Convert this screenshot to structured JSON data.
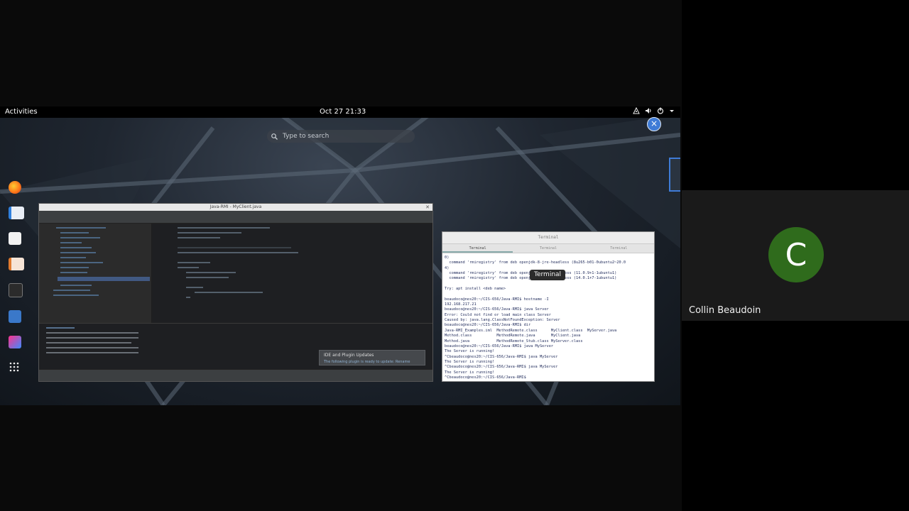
{
  "topbar": {
    "activities_label": "Activities",
    "clock": "Oct 27  21:33",
    "tray_icons": [
      "network-icon",
      "volume-icon",
      "power-icon",
      "menu-caret-icon"
    ]
  },
  "search": {
    "placeholder": "Type to search"
  },
  "dock": {
    "apps": [
      "firefox-icon",
      "writer-icon",
      "document-viewer-icon",
      "impress-icon",
      "terminal-icon",
      "files-icon",
      "intellij-icon",
      "show-apps-icon"
    ]
  },
  "ide_window": {
    "title": "Java-RMI - MyClient.java",
    "notification_title": "IDE and Plugin Updates",
    "notification_text": "The following plugin is ready to update: Rename"
  },
  "terminal_window": {
    "title": "Terminal",
    "tabs": [
      "Terminal",
      "Terminal",
      "Terminal"
    ],
    "lines": [
      "0)",
      "  command 'rmiregistry' from deb openjdk-8-jre-headless (8u265-b01-0ubuntu2~20.0",
      "4)",
      "  command 'rmiregistry' from deb openjdk-11-jre-headless (11.0.9+1-1ubuntu1)",
      "  command 'rmiregistry' from deb openjdk-14-jre-headless (14.0.1+7-1ubuntu1)",
      "",
      "Try: apt install <deb name>",
      "",
      "beaudoco@nes20:~/CIS-656/Java-RMI$ hostname -I",
      "192.168.217.21",
      "beaudoco@nes20:~/CIS-656/Java-RMI$ java Server",
      "Error: Could not find or load main class Server",
      "Caused by: java.lang.ClassNotFoundException: Server",
      "beaudoco@nes20:~/CIS-656/Java-RMI$ dir",
      "Java-RMI_Examples.iml  MethodRemote.class      MyClient.class  MyServer.java",
      "Method.class           MethodRemote.java       MyClient.java",
      "Method.java            MethodRemote_Stub.class MyServer.class",
      "beaudoco@nes20:~/CIS-656/Java-RMI$ java MyServer",
      "The Server is running!",
      "^Cbeaudoco@nes20:~/CIS-656/Java-RMI$ java MyServer",
      "The Server is running!",
      "^Cbeaudoco@nes20:~/CIS-656/Java-RMI$ java MyServer",
      "The Server is running!",
      "^Cbeaudoco@nes20:~/CIS-656/Java-RMI$ "
    ],
    "close_icon": "close-icon"
  },
  "tooltip": {
    "text": "Terminal"
  },
  "participant": {
    "initial": "C",
    "name": "Collin Beaudoin",
    "avatar_color": "#2f6b1c"
  },
  "colors": {
    "accent": "#3f7bd6",
    "panel": "#000000"
  }
}
